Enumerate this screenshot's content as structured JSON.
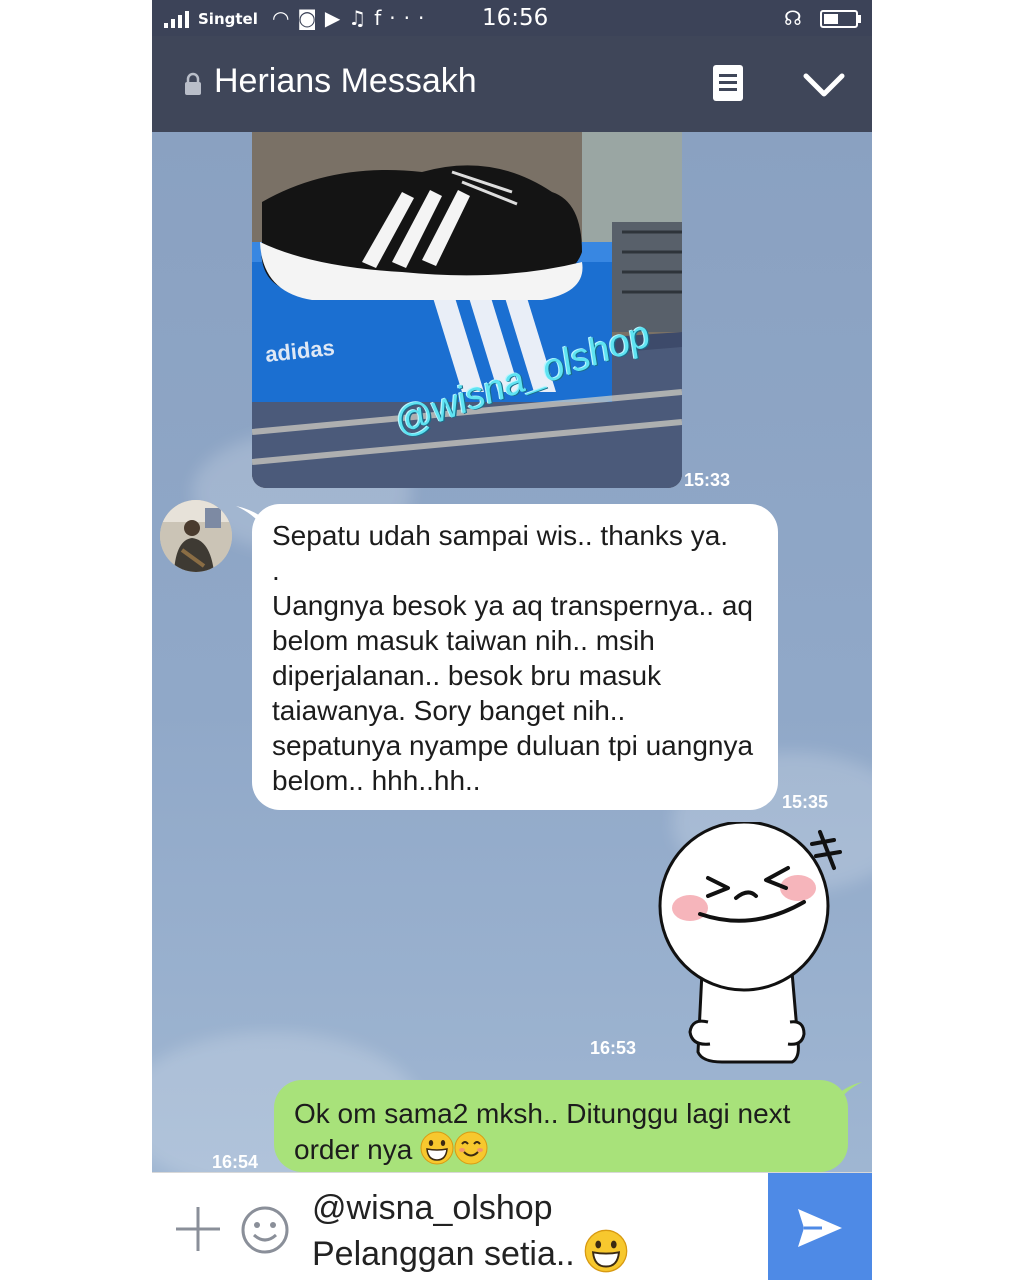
{
  "status_bar": {
    "carrier": "Singtel",
    "time": "16:56",
    "icons": [
      "signal-icon",
      "wifi-icon",
      "instagram-icon",
      "youtube-icon",
      "music-icon",
      "facebook-icon",
      "more-icon",
      "headset-icon",
      "battery-icon"
    ],
    "battery_level": 0.45
  },
  "header": {
    "title": "Herians Messakh",
    "icons": [
      "lock-icon",
      "notes-icon",
      "chevron-down-icon"
    ]
  },
  "messages": [
    {
      "type": "image",
      "direction": "outgoing",
      "watermark": "@wisna_olshop",
      "box_brand": "adidas",
      "time": "15:33"
    },
    {
      "type": "text",
      "direction": "incoming",
      "text": "Sepatu udah sampai wis.. thanks ya.\n.\nUangnya besok ya aq transpernya.. aq belom masuk taiwan nih.. msih diperjalanan.. besok bru masuk taiawanya. Sory banget nih.. sepatunya nyampe duluan tpi uangnya belom.. hhh..hh..",
      "time": "15:35"
    },
    {
      "type": "sticker",
      "direction": "outgoing",
      "time": "16:53"
    },
    {
      "type": "text",
      "direction": "outgoing",
      "text": "Ok om sama2 mksh.. Ditunggu lagi next order nya",
      "emoji": [
        "grinning-face",
        "smiling-face"
      ],
      "time": "16:54"
    }
  ],
  "input": {
    "line1": "@wisna_olshop",
    "line2": "Pelanggan setia..",
    "emoji": "grinning-face"
  },
  "colors": {
    "header": "#3f4659",
    "status_bar": "#3c4358",
    "chat_background": "#8ea4c4",
    "outgoing_bubble": "#a8e27a",
    "incoming_bubble": "#ffffff",
    "send_button": "#4e8ae6"
  }
}
